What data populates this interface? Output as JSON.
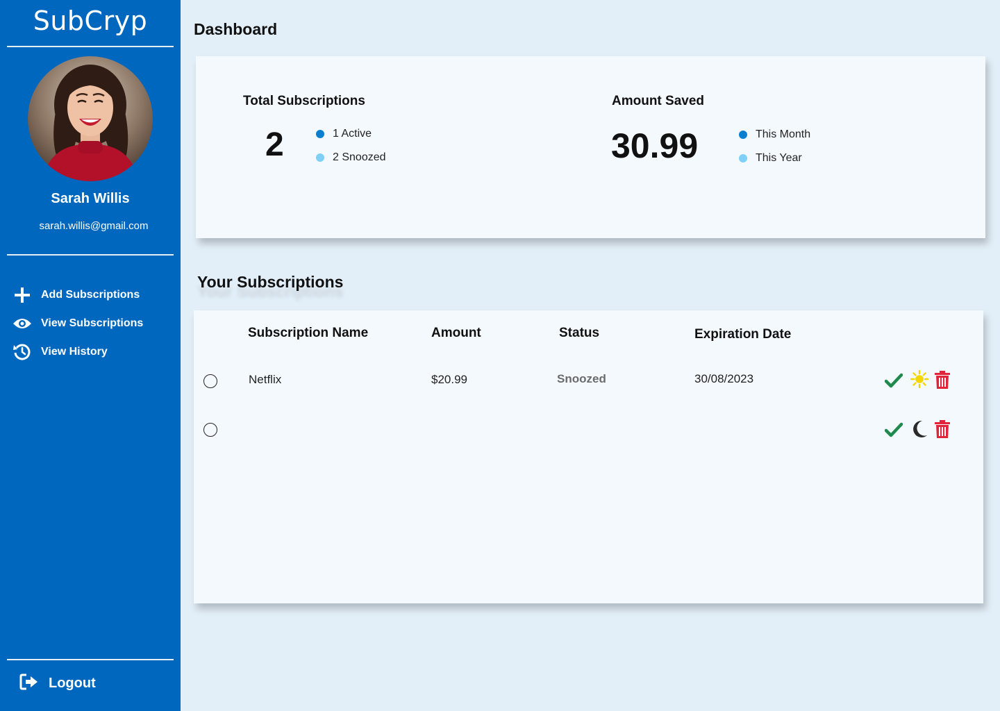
{
  "app": {
    "brand": "SubCryp"
  },
  "user": {
    "name": "Sarah Willis",
    "email": "sarah.willis@gmail.com"
  },
  "nav": {
    "items": [
      {
        "label": "Add Subscriptions",
        "icon": "plus-icon"
      },
      {
        "label": "View Subscriptions",
        "icon": "eye-icon"
      },
      {
        "label": "View History",
        "icon": "history-icon"
      }
    ],
    "logout": {
      "label": "Logout",
      "icon": "logout-icon"
    }
  },
  "dashboard": {
    "title": "Dashboard",
    "total_subscriptions": {
      "title": "Total Subscriptions",
      "value": "2",
      "legend": [
        {
          "label": "1 Active",
          "color": "#0a7fcf"
        },
        {
          "label": "2 Snoozed",
          "color": "#7fd0f6"
        }
      ]
    },
    "amount_saved": {
      "title": "Amount Saved",
      "value": "30.99",
      "legend": [
        {
          "label": "This Month",
          "color": "#0a7fcf"
        },
        {
          "label": "This Year",
          "color": "#7fd0f6"
        }
      ]
    }
  },
  "subscriptions": {
    "title": "Your Subscriptions",
    "columns": [
      "Subscription Name",
      "Amount",
      "Status",
      "Expiration Date"
    ],
    "rows": [
      {
        "name": "Netflix",
        "amount": "$20.99",
        "status": "Snoozed",
        "expiration": "30/08/2023",
        "toggle_icon": "sun-icon"
      },
      {
        "name": "",
        "amount": "",
        "status": "",
        "expiration": "",
        "toggle_icon": "moon-icon"
      }
    ]
  },
  "colors": {
    "sidebar": "#0067be",
    "background": "#e3eff8",
    "card": "#f4f9fd",
    "check": "#1f8a4c",
    "sun": "#f5d600",
    "moon": "#2a2a2a",
    "trash": "#e0243a"
  }
}
